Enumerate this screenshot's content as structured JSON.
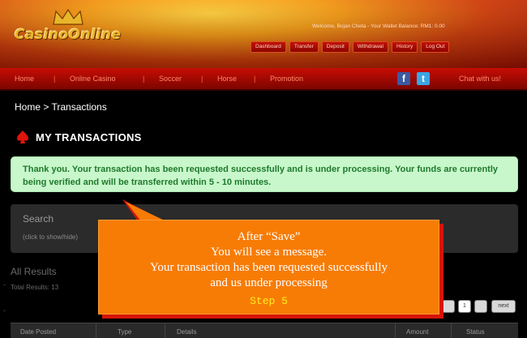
{
  "header": {
    "logo_text": "CasinoOnline",
    "welcome_text": "Welcome, Bojan Cheta - Your Wallet Balance: RM1: 0.00",
    "user_nav": [
      "Dashboard",
      "Transfer",
      "Deposit",
      "Withdrawal",
      "History",
      "Log Out"
    ]
  },
  "main_nav": {
    "items": [
      "Home",
      "Online Casino",
      "Soccer",
      "Horse",
      "Promotion"
    ],
    "chat_label": "Chat with us!"
  },
  "breadcrumb": "Home > Transactions",
  "page_title": "MY TRANSACTIONS",
  "success_message": "Thank you. Your transaction has been requested successfully and is under processing. Your funds are currently being verified and will be transferred within 5 - 10 minutes.",
  "search": {
    "title": "Search",
    "toggle_hint": "(click to show/hide)"
  },
  "results": {
    "title": "All Results",
    "total": "Total Results: 13"
  },
  "pager": {
    "page": "1",
    "next": "next"
  },
  "table_headers": [
    "Date Posted",
    "Type",
    "Details",
    "Amount",
    "Status"
  ],
  "callout": {
    "line1": "After “Save”",
    "line2": "You will see a message.",
    "line3": "Your transaction has been requested successfully",
    "line4": "and us under processing",
    "step": "Step 5"
  },
  "colors": {
    "callout_bg": "#f77c06",
    "callout_shadow": "#d6140a",
    "success_bg": "#c8f7cc",
    "success_text": "#1f7a2b",
    "nav_red": "#c60d04"
  }
}
